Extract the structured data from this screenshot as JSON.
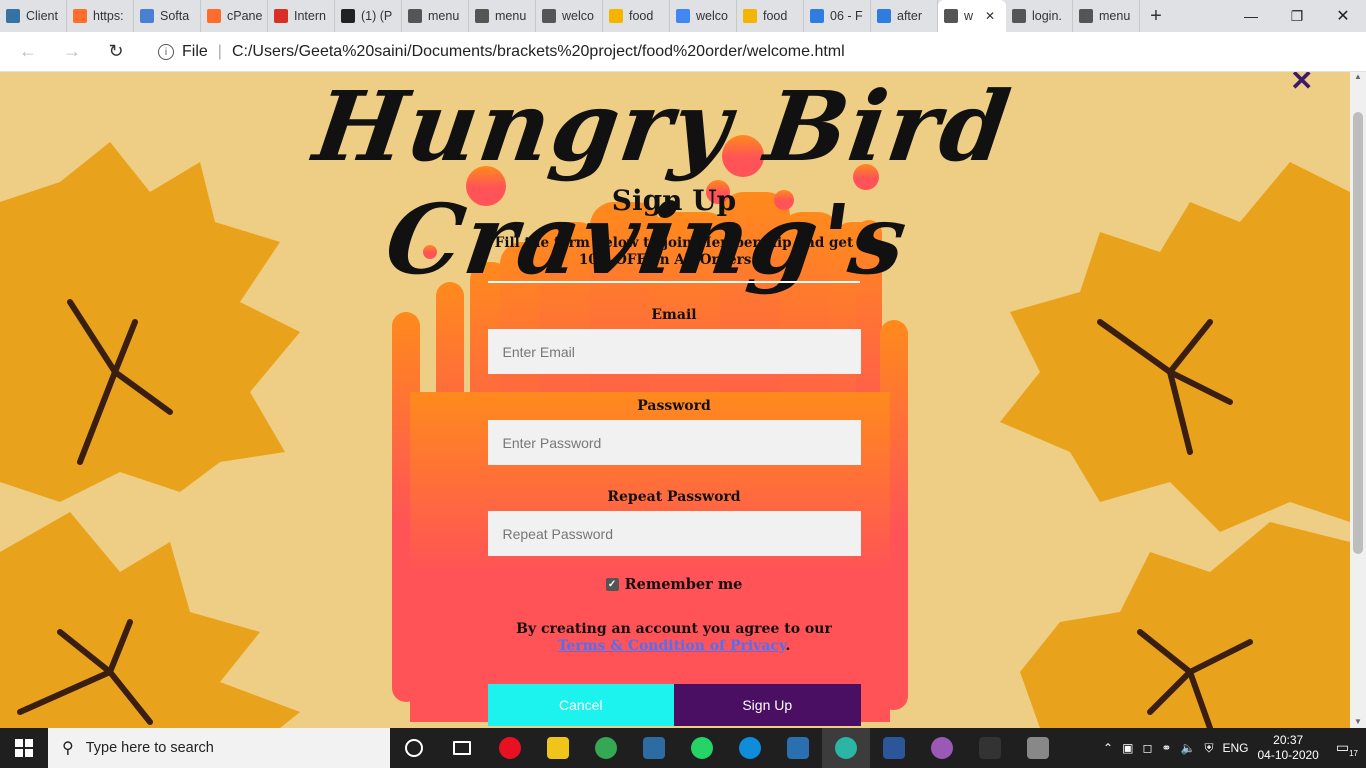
{
  "browser": {
    "tabs": [
      {
        "label": "Client",
        "icon": "python-icon",
        "color": "#3572a5"
      },
      {
        "label": "https:",
        "icon": "cpanel-icon",
        "color": "#ff6c2c"
      },
      {
        "label": "Softa",
        "icon": "pen-icon",
        "color": "#4a7fd4"
      },
      {
        "label": "cPane",
        "icon": "cpanel-icon",
        "color": "#ff6c2c"
      },
      {
        "label": "Intern",
        "icon": "pdf-icon",
        "color": "#d93025"
      },
      {
        "label": "(1) (P",
        "icon": "font-a-icon",
        "color": "#222222"
      },
      {
        "label": "menu",
        "icon": "page-icon",
        "color": "#555555"
      },
      {
        "label": "menu",
        "icon": "page-icon",
        "color": "#555555"
      },
      {
        "label": "welco",
        "icon": "page-icon",
        "color": "#555555"
      },
      {
        "label": "food",
        "icon": "drive-icon",
        "color": "#f4b400"
      },
      {
        "label": "welco",
        "icon": "docs-icon",
        "color": "#4285f4"
      },
      {
        "label": "food",
        "icon": "drive-icon",
        "color": "#f4b400"
      },
      {
        "label": "06 - F",
        "icon": "bing-icon",
        "color": "#2f7de1"
      },
      {
        "label": "after",
        "icon": "bing-icon",
        "color": "#2f7de1"
      },
      {
        "label": "w",
        "icon": "page-icon",
        "color": "#555555",
        "active": true
      },
      {
        "label": "login.",
        "icon": "page-icon",
        "color": "#555555"
      },
      {
        "label": "menu",
        "icon": "page-icon",
        "color": "#555555"
      }
    ],
    "address_label": "File",
    "url": "C:/Users/Geeta%20saini/Documents/brackets%20project/food%20order/welcome.html"
  },
  "page": {
    "brand_title": "Hungry Bird Craving's",
    "close_symbol": "✕",
    "form": {
      "heading": "Sign Up",
      "description": "Fill the form below to join Membership and get 10% OFF on All Orders!!!",
      "email_label": "Email",
      "email_placeholder": "Enter Email",
      "password_label": "Password",
      "password_placeholder": "Enter Password",
      "repeat_label": "Repeat Password",
      "repeat_placeholder": "Repeat Password",
      "remember_label": "Remember me",
      "remember_checked": true,
      "terms_prefix": "By creating an account you agree to our ",
      "terms_link": "Terms & Condition of Privacy",
      "terms_suffix": ".",
      "cancel_label": "Cancel",
      "signup_label": "Sign Up"
    },
    "colors": {
      "background": "#eecd84",
      "leaf": "#e9a21c",
      "drip_top": "#ff8a1c",
      "drip_bottom": "#ff5357",
      "cancel": "#1cf2ee",
      "signup": "#4a0e63",
      "link": "#4f6ff7"
    }
  },
  "taskbar": {
    "search_placeholder": "Type here to search",
    "apps": [
      {
        "name": "cortana-icon"
      },
      {
        "name": "task-view-icon"
      },
      {
        "name": "media-player-icon",
        "color": "#e81123"
      },
      {
        "name": "file-explorer-icon",
        "color": "#f0c419"
      },
      {
        "name": "chrome-icon",
        "color": "#34a853"
      },
      {
        "name": "dev-icon",
        "color": "#2d6ca2"
      },
      {
        "name": "whatsapp-icon",
        "color": "#25d366"
      },
      {
        "name": "edge-icon",
        "color": "#0f8cda"
      },
      {
        "name": "brackets-icon",
        "color": "#2a6fb0"
      },
      {
        "name": "edge-beta-icon",
        "color": "#2ab5a5",
        "active": true
      },
      {
        "name": "word-icon",
        "color": "#2b579a"
      },
      {
        "name": "github-icon",
        "color": "#9b59b6"
      },
      {
        "name": "terminal-icon",
        "color": "#333333"
      },
      {
        "name": "paint-icon",
        "color": "#888888"
      }
    ],
    "language": "ENG",
    "time": "20:37",
    "date": "04-10-2020",
    "notification_count": "17"
  }
}
